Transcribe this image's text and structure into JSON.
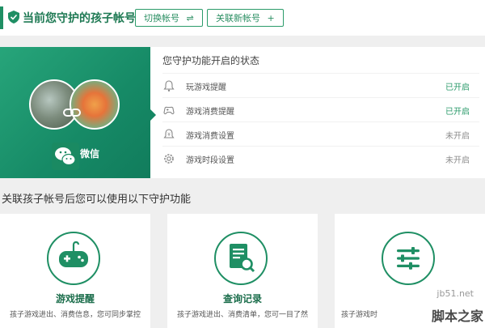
{
  "header": {
    "title": "当前您守护的孩子帐号",
    "switch_button": "切换帐号",
    "link_new_button": "关联新帐号",
    "switch_icon": "swap-icon",
    "add_icon": "plus-icon"
  },
  "status_card": {
    "account_type": "微信",
    "heading": "您守护功能开启的状态",
    "rows": [
      {
        "label": "玩游戏提醒",
        "status": "已开启",
        "icon": "bell-icon"
      },
      {
        "label": "游戏消费提醒",
        "status": "已开启",
        "icon": "gamepad-icon"
      },
      {
        "label": "游戏消费设置",
        "status": "未开启",
        "icon": "yen-icon"
      },
      {
        "label": "游戏时段设置",
        "status": "未开启",
        "icon": "gear-icon"
      }
    ]
  },
  "features_section": {
    "title": "关联孩子帐号后您可以使用以下守护功能",
    "cards": [
      {
        "title": "游戏提醒",
        "desc": "孩子游戏进出、消费信息，您可同步掌控",
        "icon": "gamepad-icon"
      },
      {
        "title": "查询记录",
        "desc": "孩子游戏进出、消费清单，您可一目了然",
        "icon": "document-search-icon"
      },
      {
        "title": "",
        "desc": "孩子游戏时",
        "icon": "sliders-icon"
      }
    ]
  },
  "watermark": {
    "site": "jb51.net",
    "name": "脚本之家"
  },
  "colors": {
    "accent": "#1f8f64",
    "enabled": "#2a9a6a",
    "disabled": "#8c8c8c"
  }
}
